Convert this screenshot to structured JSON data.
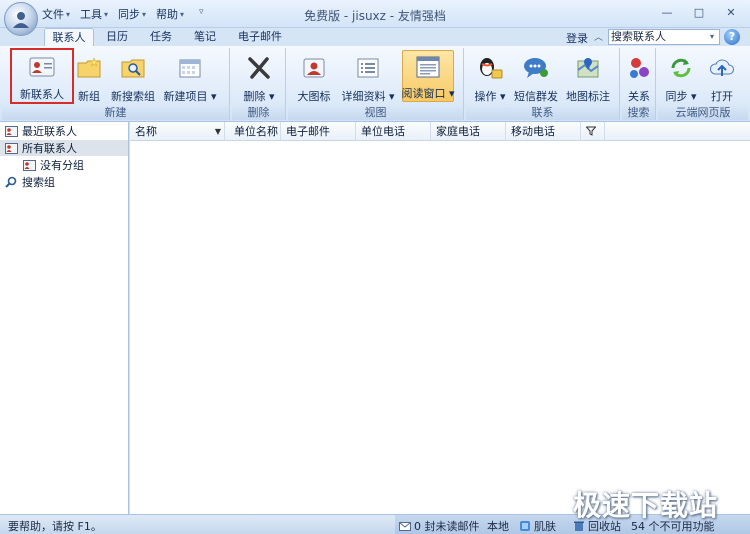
{
  "window": {
    "title": "免费版 - jisuxz - 友情强档",
    "minimize": "—",
    "maximize": "□",
    "close": "✕"
  },
  "menu": [
    {
      "label": "文件"
    },
    {
      "label": "工具"
    },
    {
      "label": "同步"
    },
    {
      "label": "帮助"
    }
  ],
  "tabs": [
    {
      "label": "联系人",
      "active": true
    },
    {
      "label": "日历"
    },
    {
      "label": "任务"
    },
    {
      "label": "笔记"
    },
    {
      "label": "电子邮件"
    }
  ],
  "topright": {
    "login": "登录",
    "search_value": "搜索联系人",
    "help": "?"
  },
  "ribbon": {
    "groups": [
      {
        "label": "新建",
        "buttons": [
          "新联系人",
          "新组",
          "新搜索组",
          "新建项目 ▾"
        ]
      },
      {
        "label": "删除",
        "buttons": [
          "删除 ▾"
        ]
      },
      {
        "label": "视图",
        "buttons": [
          "大图标",
          "详细资料 ▾",
          "阅读窗口 ▾"
        ]
      },
      {
        "label": "联系",
        "buttons": [
          "操作 ▾",
          "短信群发",
          "地图标注"
        ]
      },
      {
        "label": "搜索",
        "buttons": [
          "关系"
        ]
      },
      {
        "label": "云端网页版",
        "buttons": [
          "同步 ▾",
          "打开"
        ]
      }
    ]
  },
  "nav": [
    {
      "label": "最近联系人"
    },
    {
      "label": "所有联系人",
      "selected": true
    },
    {
      "label": "没有分组"
    },
    {
      "label": "搜索组"
    }
  ],
  "columns": [
    "名称",
    "单位名称",
    "电子邮件",
    "单位电话",
    "家庭电话",
    "移动电话"
  ],
  "status": {
    "help_text": "要帮助，请按 F1。",
    "unread": "0 封未读邮件",
    "local": "本地",
    "skin": "肌肤",
    "recycle": "回收站",
    "unavailable": "54 个不可用功能"
  },
  "watermark": "极速下载站",
  "colors": {
    "accent": "#d62c2c",
    "ribbon_bg": "#e3eefb",
    "selection": "#dde3ea"
  }
}
